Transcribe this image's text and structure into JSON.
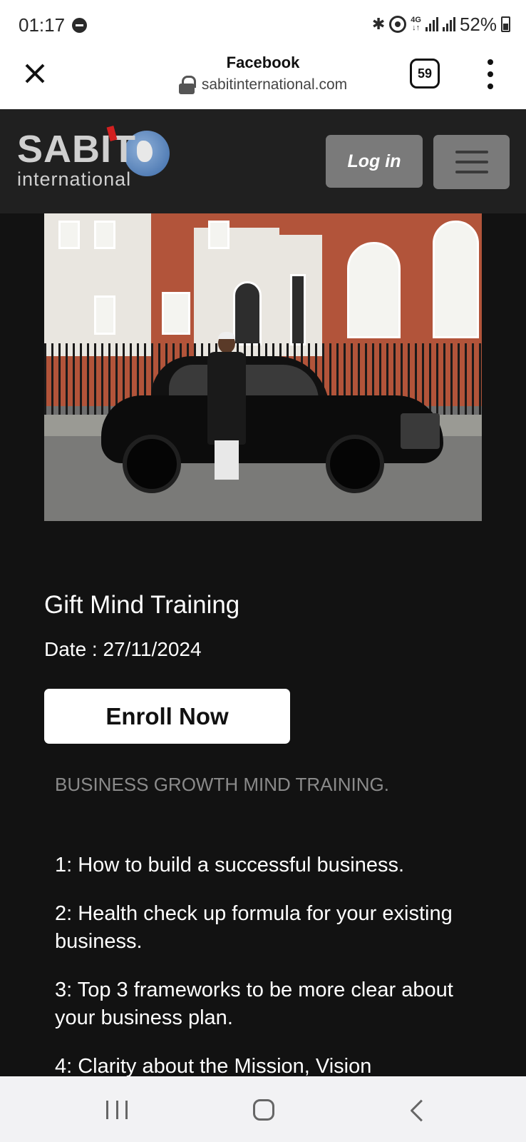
{
  "status_bar": {
    "time": "01:17",
    "network_label_top": "4G",
    "network_label_bottom": "↓↑",
    "battery": "52%",
    "icons": [
      "do-not-disturb-icon",
      "bluetooth-icon",
      "hotspot-icon",
      "signal-icon",
      "signal-icon",
      "battery-icon"
    ]
  },
  "browser": {
    "title": "Facebook",
    "url": "sabitinternational.com",
    "tab_count": "59"
  },
  "site_header": {
    "logo_text_main": "SABIT",
    "logo_text_sub": "international",
    "login_label": "Log in"
  },
  "event": {
    "title": "Gift Mind Training",
    "date": "Date : 27/11/2024",
    "enroll_label": "Enroll Now"
  },
  "content": {
    "section_heading": "BUSINESS GROWTH MIND TRAINING.",
    "items": [
      "1: How to build a successful business.",
      "2: Health check up formula for your existing business.",
      "3: Top 3 frameworks to be more clear about your business plan.",
      "4: Clarity about the Mission, Vision"
    ]
  },
  "colors": {
    "page_background": "#121212",
    "header_background": "#202020",
    "button_gray": "#7a7a7a",
    "muted_text": "#8a8a8a",
    "logo_red": "#d32020",
    "logo_blue": "#3b6aa8"
  }
}
